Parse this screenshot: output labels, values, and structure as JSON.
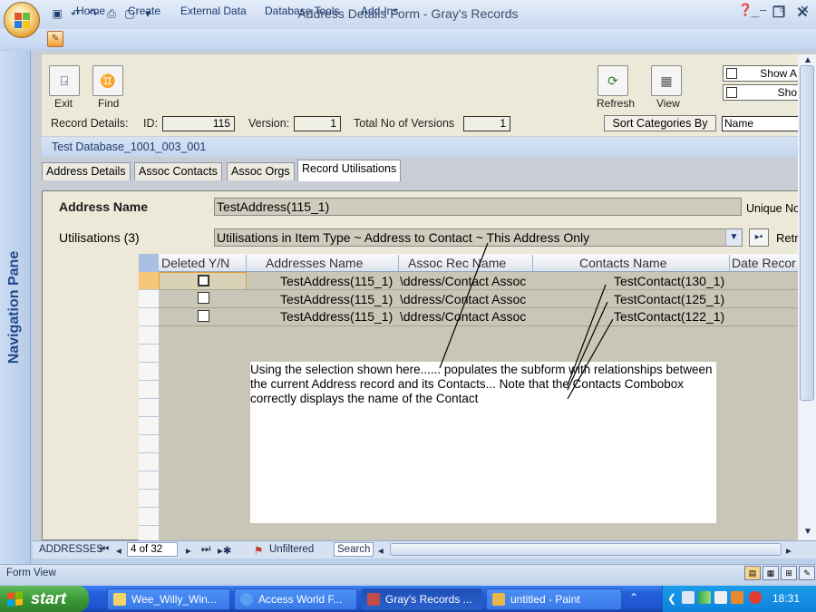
{
  "window": {
    "title": "Address Details Form - Gray's Records"
  },
  "ribbon": {
    "tabs": [
      "Home",
      "Create",
      "External Data",
      "Database Tools",
      "Add-Ins"
    ]
  },
  "nav_pane": {
    "label": "Navigation Pane",
    "chevron": "»"
  },
  "toolbar": {
    "exit_label": "Exit",
    "find_label": "Find",
    "refresh_label": "Refresh",
    "view_label": "View",
    "show_all_label": "Show A",
    "show_label": "Sho"
  },
  "record": {
    "details_label": "Record Details:",
    "id_label": "ID:",
    "id_value": "115",
    "version_label": "Version:",
    "version_value": "1",
    "total_versions_label": "Total No of Versions",
    "total_versions_value": "1",
    "sort_label": "Sort Categories By",
    "sort_value": "Name"
  },
  "database_name": "Test Database_1001_003_001",
  "form_tabs": [
    "Address Details",
    "Assoc Contacts",
    "Assoc Orgs",
    "Record Utilisations"
  ],
  "active_tab": "Record Utilisations",
  "address": {
    "name_label": "Address Name",
    "name_value": "TestAddress(115_1)",
    "unique_label": "Unique No"
  },
  "utilisations": {
    "label": "Utilisations (3)",
    "combo_value": "Utilisations in Item Type ~ Address to Contact ~ This Address Only",
    "ret_label": "Retr"
  },
  "datasheet": {
    "columns": [
      "Deleted Y/N",
      "Addresses Name",
      "Assoc Rec Name",
      "Contacts Name",
      "Date Recor"
    ],
    "rows": [
      {
        "deleted": false,
        "address": "TestAddress(115_1)",
        "assoc": "\\ddress/Contact Assoc",
        "contact": "TestContact(130_1)"
      },
      {
        "deleted": false,
        "address": "TestAddress(115_1)",
        "assoc": "\\ddress/Contact Assoc",
        "contact": "TestContact(125_1)"
      },
      {
        "deleted": false,
        "address": "TestAddress(115_1)",
        "assoc": "\\ddress/Contact Assoc",
        "contact": "TestContact(122_1)"
      }
    ]
  },
  "annotation": {
    "text": "Using the selection shown here...... populates the subform with relationships between the current Address record and its Contacts... Note that the Contacts Combobox correctly displays the name of the Contact"
  },
  "record_nav": {
    "object_label": "ADDRESSES",
    "record_position": "4 of 32",
    "filter_label": "Unfiltered",
    "search_label": "Search"
  },
  "status": {
    "text": "Form View"
  },
  "taskbar": {
    "start_label": "start",
    "tasks": [
      "Wee_Willy_Win...",
      "Access World F...",
      "Gray's Records ...",
      "untitled - Paint"
    ],
    "clock": "18:31"
  },
  "colors": {
    "ribbon_text": "#1b3b73",
    "form_background": "#ece9d8",
    "taskbar_blue": "#245edb",
    "start_green": "#3c9a38"
  }
}
